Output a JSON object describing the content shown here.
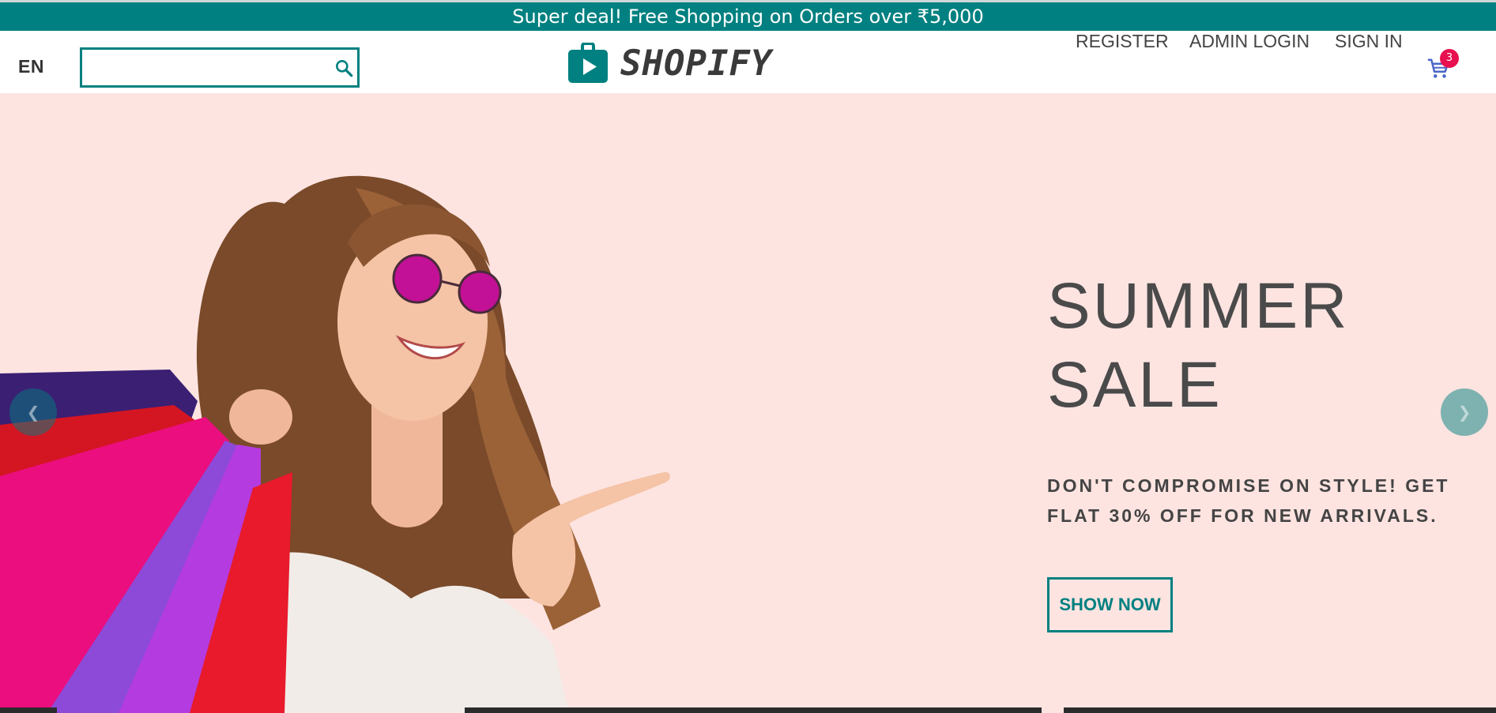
{
  "announcement": {
    "text": "Super deal! Free Shopping on Orders over ₹5,000"
  },
  "header": {
    "language": "EN",
    "search": {
      "value": "",
      "placeholder": "",
      "icon": "search-icon"
    },
    "logo": {
      "text": "SHOPIFY",
      "icon": "shopping-bag-play-icon"
    },
    "nav": [
      {
        "label": "REGISTER"
      },
      {
        "label": "ADMIN LOGIN"
      },
      {
        "label": "SIGN IN"
      }
    ],
    "cart": {
      "icon": "cart-icon",
      "count": "3"
    }
  },
  "hero": {
    "title_line1": "SUMMER",
    "title_line2": "SALE",
    "description": "DON'T COMPROMISE ON STYLE! GET FLAT 30% OFF FOR NEW ARRIVALS.",
    "button_label": "SHOW NOW",
    "prev_icon": "chevron-left-icon",
    "next_icon": "chevron-right-icon"
  },
  "colors": {
    "brand": "#008080",
    "hero_bg": "#fde4e1",
    "badge": "#e8104f",
    "text_dark": "#4a4a4a"
  }
}
